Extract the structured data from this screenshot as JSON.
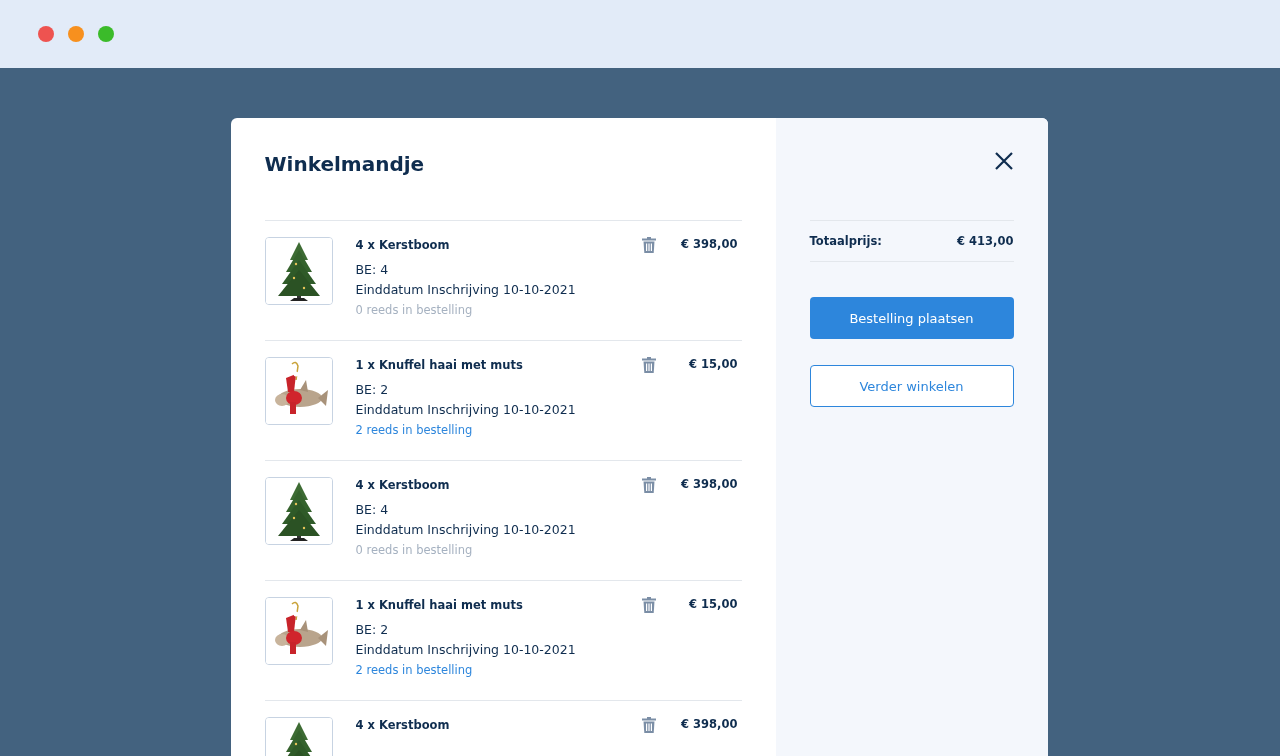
{
  "title": "Winkelmandje",
  "items": [
    {
      "name": "4 x Kerstboom",
      "price": "€ 398,00",
      "be": "BE: 4",
      "date": "Einddatum Inschrijving 10-10-2021",
      "note": "0 reeds in bestelling",
      "note_active": false
    },
    {
      "name": "1 x Knuffel haai met muts",
      "price": "€ 15,00",
      "be": "BE: 2",
      "date": "Einddatum Inschrijving 10-10-2021",
      "note": "2 reeds in bestelling",
      "note_active": true
    },
    {
      "name": "4 x Kerstboom",
      "price": "€ 398,00",
      "be": "BE: 4",
      "date": "Einddatum Inschrijving 10-10-2021",
      "note": "0 reeds in bestelling",
      "note_active": false
    },
    {
      "name": "1 x Knuffel haai met muts",
      "price": "€ 15,00",
      "be": "BE: 2",
      "date": "Einddatum Inschrijving 10-10-2021",
      "note": "2 reeds in bestelling",
      "note_active": true
    },
    {
      "name": "4 x Kerstboom",
      "price": "€ 398,00"
    }
  ],
  "summary": {
    "label": "Totaalprijs:",
    "value": "€ 413,00"
  },
  "buttons": [
    {
      "label": "Bestelling plaatsen",
      "kind": "primary"
    },
    {
      "label": "Verder winkelen",
      "kind": "secondary"
    }
  ]
}
